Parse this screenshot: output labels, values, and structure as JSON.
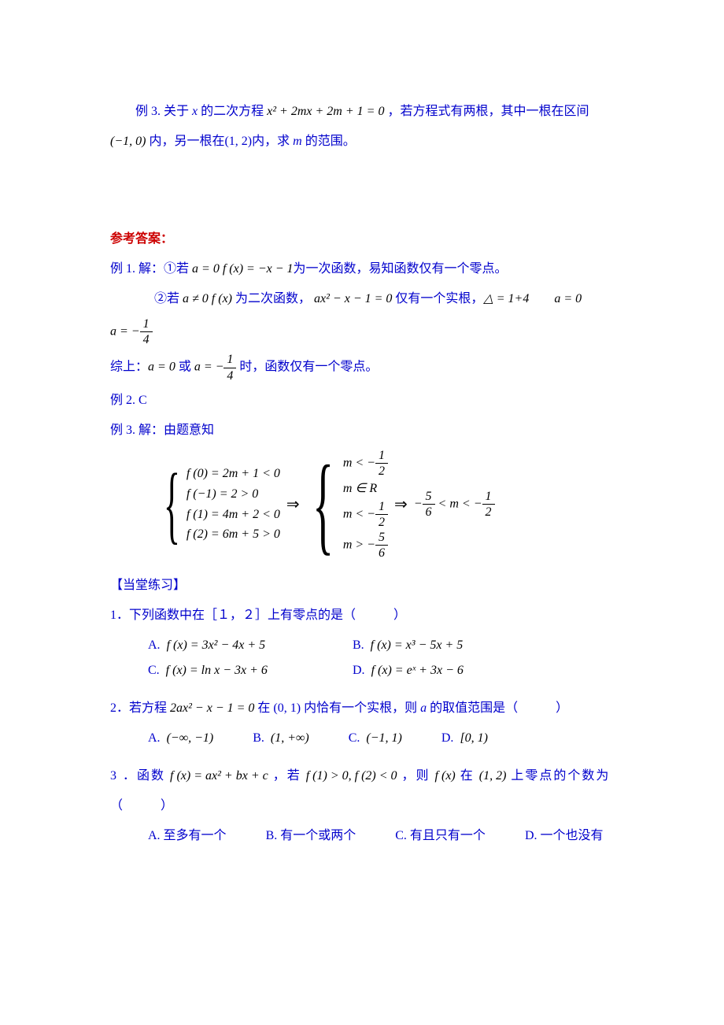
{
  "example3": {
    "line1_a": "例 3. 关于",
    "line1_x": " x ",
    "line1_b": "的二次方程",
    "line1_eq": " x² + 2mx + 2m + 1 = 0 ",
    "line1_c": "，若方程式有两根，其中一根在区间",
    "line2_a": "(−1, 0) ",
    "line2_b": "内，另一根在",
    "line2_c": "(1, 2)",
    "line2_d": "内，求 ",
    "line2_m": "m",
    "line2_e": " 的范围。"
  },
  "answer_header": "参考答案：",
  "ans1": {
    "a": "例 1. 解：①若 ",
    "eq1": "a = 0   f (x) = −x − 1",
    "b": "为一次函数，易知函数仅有一个零点。",
    "c": "②若 ",
    "eq2": "a ≠ 0   f (x)",
    "d": " 为二次函数，",
    "eq3": " ax² − x − 1 = 0",
    "e": " 仅有一个实根，",
    "eq4": "△ = 1+4",
    "eq5": "a = 0",
    "lhs": "a = −",
    "frac_num": "1",
    "frac_den": "4",
    "sum_a": "综上：",
    "sum_eq1": "a = 0",
    "sum_b": " 或 ",
    "sum_eq2": "a = −",
    "sum_c": " 时，函数仅有一个零点。"
  },
  "ans2": "例 2. C",
  "ans3": {
    "intro": "例 3. 解：由题意知",
    "sys1": {
      "l1": "f (0) = 2m + 1 < 0",
      "l2": "f (−1) = 2 > 0",
      "l3": "f (1) = 4m + 2 < 0",
      "l4": "f (2) = 6m + 5 > 0"
    },
    "sys2": {
      "l1a": "m < −",
      "l1n": "1",
      "l1d": "2",
      "l2": "m ∈ R",
      "l3a": "m < −",
      "l3n": "1",
      "l3d": "2",
      "l4a": "m > −",
      "l4n": "5",
      "l4d": "6"
    },
    "final_a": "−",
    "final_n1": "5",
    "final_d1": "6",
    "final_mid": " < m < −",
    "final_n2": "1",
    "final_d2": "2"
  },
  "practice_header": "【当堂练习】",
  "q1": {
    "text": "1．下列函数中在［１，２］上有零点的是（　　　）",
    "A_l": "A.",
    "A": " f (x) = 3x² − 4x + 5",
    "B_l": "B.",
    "B": " f (x) = x³ − 5x + 5",
    "C_l": "C.",
    "C": " f (x) = ln x − 3x + 6",
    "D_l": "D.",
    "D": " f (x) = eˣ + 3x − 6"
  },
  "q2": {
    "a": "2．若方程 ",
    "eq": "2ax² − x − 1 = 0",
    "b": " 在 ",
    "int": "(0, 1)",
    "c": " 内恰有一个实根，则 ",
    "av": "a",
    "d": " 的取值范围是（　　　）",
    "A_l": "A.",
    "A": " (−∞, −1)",
    "B_l": "B.",
    "B": " (1, +∞)",
    "C_l": "C.",
    "C": " (−1, 1)",
    "D_l": "D.",
    "D": " [0, 1)"
  },
  "q3": {
    "a": "3 ．函数 ",
    "eq1": "f (x) = ax² + bx + c",
    "b": " ，若 ",
    "eq2": "f (1) > 0, f (2) < 0",
    "c": " ，则 ",
    "eq3": "f (x)",
    "d": " 在 ",
    "int": "(1, 2)",
    "e": " 上零点的个数为",
    "paren": "（　　　）",
    "A": "A. 至多有一个",
    "B": "B. 有一个或两个",
    "C": "C. 有且只有一个",
    "D": "D. 一个也没有"
  }
}
